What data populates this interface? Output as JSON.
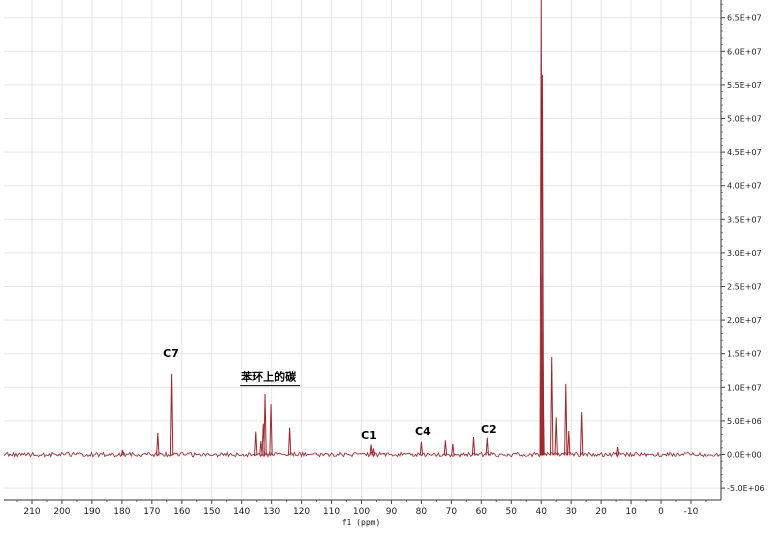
{
  "chart_data": {
    "type": "line",
    "xlabel": "f1 (ppm)",
    "ylabel": "",
    "x_reversed": true,
    "xlim": [
      220,
      -20
    ],
    "ylim": [
      -5000000,
      69000000
    ],
    "x_ticks": [
      210,
      200,
      190,
      180,
      170,
      160,
      150,
      140,
      130,
      120,
      110,
      100,
      90,
      80,
      70,
      60,
      50,
      40,
      30,
      20,
      10,
      0,
      -10
    ],
    "x_tick_labels": [
      "210",
      "200",
      "190",
      "180",
      "170",
      "160",
      "150",
      "140",
      "130",
      "120",
      "110",
      "100",
      "90",
      "80",
      "70",
      "60",
      "50",
      "40",
      "30",
      "20",
      "10",
      "0",
      "-10"
    ],
    "y_ticks": [
      -5000000,
      0,
      5000000,
      10000000,
      15000000,
      20000000,
      25000000,
      30000000,
      35000000,
      40000000,
      45000000,
      50000000,
      55000000,
      60000000,
      65000000
    ],
    "y_tick_labels": [
      "-5.0E+06",
      "0.0E+00",
      "5.0E+06",
      "1.0E+07",
      "1.5E+07",
      "2.0E+07",
      "2.5E+07",
      "3.0E+07",
      "3.5E+07",
      "4.0E+07",
      "4.5E+07",
      "5.0E+07",
      "5.5E+07",
      "6.0E+07",
      "6.5E+07"
    ],
    "grid": true,
    "series_color": "#a0262c",
    "baseline": 0,
    "peaks": [
      {
        "x": 179.8,
        "y": 700000
      },
      {
        "x": 168.0,
        "y": 3200000
      },
      {
        "x": 163.4,
        "y": 12000000
      },
      {
        "x": 135.3,
        "y": 3400000
      },
      {
        "x": 133.6,
        "y": 2000000
      },
      {
        "x": 132.8,
        "y": 4600000
      },
      {
        "x": 132.2,
        "y": 9000000
      },
      {
        "x": 130.2,
        "y": 7500000
      },
      {
        "x": 124.0,
        "y": 4000000
      },
      {
        "x": 96.8,
        "y": 1500000
      },
      {
        "x": 96.0,
        "y": 900000
      },
      {
        "x": 80.0,
        "y": 1900000
      },
      {
        "x": 72.0,
        "y": 2100000
      },
      {
        "x": 69.5,
        "y": 1600000
      },
      {
        "x": 62.6,
        "y": 2600000
      },
      {
        "x": 58.0,
        "y": 2500000
      },
      {
        "x": 40.0,
        "y": 69000000
      },
      {
        "x": 39.6,
        "y": 56500000
      },
      {
        "x": 39.8,
        "y": 27000000
      },
      {
        "x": 39.4,
        "y": 13000000
      },
      {
        "x": 36.5,
        "y": 14500000
      },
      {
        "x": 35.0,
        "y": 5500000
      },
      {
        "x": 31.8,
        "y": 10500000
      },
      {
        "x": 30.8,
        "y": 3500000
      },
      {
        "x": 26.5,
        "y": 6300000
      },
      {
        "x": 14.5,
        "y": 1100000
      }
    ],
    "annotations": [
      {
        "label": "C7",
        "x": 163.6,
        "y": 14500000
      },
      {
        "label": "苯环上的碳",
        "x": 131.0,
        "y": 11000000,
        "bracket": [
          140.5,
          120.5
        ]
      },
      {
        "label": "C1",
        "x": 97.5,
        "y": 2300000
      },
      {
        "label": "C4",
        "x": 79.5,
        "y": 2900000
      },
      {
        "label": "C2",
        "x": 57.5,
        "y": 3200000
      }
    ]
  }
}
